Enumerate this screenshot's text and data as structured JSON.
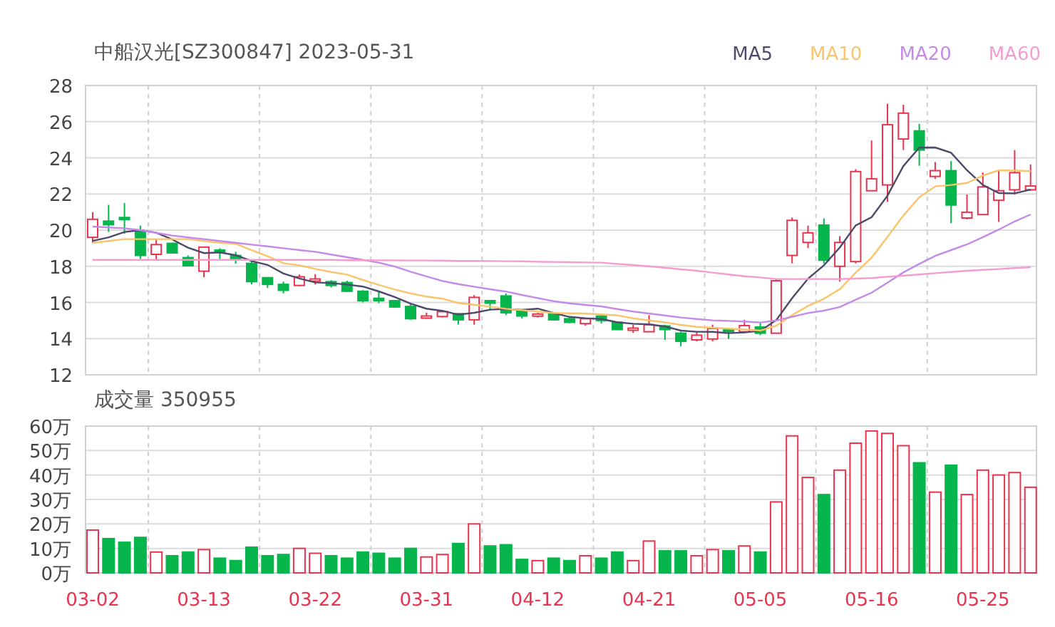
{
  "price_chart": {
    "title": "中船汉光[SZ300847] 2023-05-31",
    "chart_data": {
      "type": "candlestick",
      "grid": true,
      "ylim": [
        12,
        28
      ],
      "yticks": [
        12,
        14,
        16,
        18,
        20,
        22,
        24,
        26,
        28
      ],
      "categories": [
        null,
        null,
        null,
        null,
        null,
        null,
        null,
        null,
        null,
        null,
        null,
        null,
        null,
        null,
        null,
        null,
        null,
        null,
        null,
        null,
        null,
        null,
        null,
        null,
        null,
        null,
        null,
        null,
        null,
        null,
        null,
        null,
        null,
        null,
        null,
        null,
        null,
        null,
        null,
        null,
        null,
        null,
        null,
        null,
        null,
        null,
        null,
        null,
        null,
        null,
        null,
        null,
        null,
        null,
        null,
        null,
        null,
        null,
        null,
        null
      ],
      "series": [
        {
          "name": "MA5",
          "type": "line",
          "color": "#4b4a6b",
          "values": [
            19.4,
            19.6,
            19.9,
            20.0,
            19.86,
            19.49,
            19.03,
            18.73,
            18.77,
            18.61,
            18.29,
            18.08,
            17.6,
            17.33,
            17.11,
            17.07,
            16.99,
            16.88,
            16.61,
            16.3,
            15.93,
            15.66,
            15.54,
            15.33,
            15.43,
            15.6,
            15.64,
            15.59,
            15.66,
            15.41,
            15.2,
            15.13,
            15.08,
            14.91,
            14.82,
            14.79,
            14.67,
            14.44,
            14.38,
            14.37,
            14.3,
            14.34,
            14.43,
            15.03,
            16.23,
            17.32,
            18.05,
            19.05,
            20.26,
            20.72,
            21.91,
            23.54,
            24.56,
            24.57,
            24.28,
            23.31,
            22.5,
            22.05,
            22.03,
            22.24
          ]
        },
        {
          "name": "MA10",
          "type": "line",
          "color": "#f9c46b",
          "values": [
            19.3,
            19.4,
            19.5,
            19.5,
            19.5,
            19.5,
            19.5,
            19.4,
            19.3,
            19.24,
            18.89,
            18.56,
            18.17,
            18.05,
            17.86,
            17.68,
            17.54,
            17.24,
            16.97,
            16.71,
            16.5,
            16.33,
            16.21,
            15.97,
            15.87,
            15.77,
            15.65,
            15.57,
            15.5,
            15.42,
            15.4,
            15.39,
            15.34,
            15.29,
            15.12,
            15.0,
            14.9,
            14.76,
            14.65,
            14.6,
            14.55,
            14.51,
            14.44,
            14.71,
            15.3,
            15.81,
            16.2,
            16.74,
            17.65,
            18.48,
            19.62,
            20.8,
            21.81,
            22.42,
            22.5,
            22.61,
            23.02,
            23.31,
            23.3,
            23.26
          ]
        },
        {
          "name": "MA20",
          "type": "line",
          "color": "#c58ae8",
          "values": [
            20.2,
            20.15,
            20.1,
            20.0,
            19.85,
            19.7,
            19.6,
            19.5,
            19.4,
            19.3,
            19.2,
            19.1,
            19.0,
            18.9,
            18.8,
            18.65,
            18.5,
            18.35,
            18.2,
            17.98,
            17.7,
            17.45,
            17.19,
            17.01,
            16.87,
            16.73,
            16.6,
            16.41,
            16.24,
            16.07,
            15.95,
            15.86,
            15.78,
            15.63,
            15.5,
            15.39,
            15.28,
            15.17,
            15.08,
            15.01,
            14.98,
            14.95,
            14.89,
            15.0,
            15.21,
            15.41,
            15.55,
            15.75,
            16.15,
            16.54,
            17.09,
            17.66,
            18.13,
            18.57,
            18.9,
            19.21,
            19.61,
            20.03,
            20.48,
            20.87
          ]
        },
        {
          "name": "MA60",
          "type": "line",
          "color": "#f59ccf",
          "values": [
            18.35,
            18.35,
            18.35,
            18.35,
            18.35,
            18.35,
            18.35,
            18.35,
            18.35,
            18.35,
            18.35,
            18.35,
            18.35,
            18.35,
            18.35,
            18.35,
            18.34,
            18.34,
            18.33,
            18.33,
            18.32,
            18.32,
            18.31,
            18.3,
            18.3,
            18.29,
            18.28,
            18.27,
            18.25,
            18.24,
            18.23,
            18.21,
            18.2,
            18.13,
            18.07,
            18.0,
            17.92,
            17.83,
            17.75,
            17.65,
            17.55,
            17.45,
            17.38,
            17.3,
            17.3,
            17.3,
            17.3,
            17.3,
            17.32,
            17.35,
            17.42,
            17.48,
            17.55,
            17.62,
            17.68,
            17.75,
            17.8,
            17.85,
            17.9,
            17.95
          ]
        }
      ],
      "ohlc": [
        [
          19.6,
          21.0,
          19.3,
          20.6
        ],
        [
          20.5,
          21.4,
          19.9,
          20.3
        ],
        [
          20.7,
          21.5,
          19.8,
          20.6
        ],
        [
          19.95,
          20.25,
          18.4,
          18.6
        ],
        [
          18.66,
          19.5,
          18.35,
          19.2
        ],
        [
          19.27,
          19.3,
          18.7,
          18.74
        ],
        [
          18.48,
          18.6,
          18.0,
          18.03
        ],
        [
          17.73,
          19.06,
          17.4,
          19.06
        ],
        [
          18.9,
          19.0,
          18.4,
          18.8
        ],
        [
          18.6,
          18.8,
          18.15,
          18.4
        ],
        [
          18.16,
          18.27,
          17.0,
          17.15
        ],
        [
          17.37,
          17.4,
          16.8,
          17.0
        ],
        [
          17.0,
          17.15,
          16.5,
          16.67
        ],
        [
          16.94,
          17.55,
          16.9,
          17.42
        ],
        [
          17.2,
          17.57,
          17.0,
          17.3
        ],
        [
          17.15,
          17.23,
          16.83,
          16.94
        ],
        [
          17.1,
          17.2,
          16.57,
          16.62
        ],
        [
          16.62,
          16.68,
          16.0,
          16.1
        ],
        [
          16.23,
          16.6,
          15.96,
          16.1
        ],
        [
          16.1,
          16.1,
          15.7,
          15.75
        ],
        [
          15.78,
          15.9,
          15.04,
          15.1
        ],
        [
          15.17,
          15.43,
          15.1,
          15.25
        ],
        [
          15.22,
          15.57,
          15.17,
          15.49
        ],
        [
          15.38,
          15.43,
          14.77,
          15.04
        ],
        [
          15.04,
          16.41,
          14.77,
          16.28
        ],
        [
          16.1,
          16.1,
          15.62,
          15.96
        ],
        [
          16.36,
          16.5,
          15.3,
          15.43
        ],
        [
          15.57,
          15.62,
          15.12,
          15.25
        ],
        [
          15.25,
          15.43,
          15.17,
          15.36
        ],
        [
          15.36,
          15.4,
          15.0,
          15.04
        ],
        [
          15.1,
          15.15,
          14.85,
          14.9
        ],
        [
          14.83,
          15.17,
          14.72,
          15.1
        ],
        [
          15.25,
          15.3,
          14.83,
          15.0
        ],
        [
          14.9,
          14.93,
          14.5,
          14.5
        ],
        [
          14.5,
          14.77,
          14.32,
          14.58
        ],
        [
          14.38,
          15.3,
          14.38,
          14.77
        ],
        [
          14.7,
          14.77,
          13.93,
          14.5
        ],
        [
          14.3,
          14.38,
          13.58,
          13.85
        ],
        [
          13.93,
          14.38,
          13.85,
          14.19
        ],
        [
          13.98,
          14.77,
          13.85,
          14.56
        ],
        [
          14.5,
          14.59,
          13.98,
          14.38
        ],
        [
          14.38,
          15.04,
          14.3,
          14.72
        ],
        [
          14.64,
          14.9,
          14.19,
          14.3
        ],
        [
          14.3,
          17.28,
          14.3,
          17.2
        ],
        [
          18.6,
          20.7,
          18.16,
          20.54
        ],
        [
          19.32,
          20.25,
          19.0,
          19.85
        ],
        [
          20.28,
          20.65,
          18.16,
          18.34
        ],
        [
          18.0,
          19.67,
          17.15,
          19.32
        ],
        [
          18.26,
          23.37,
          18.16,
          23.24
        ],
        [
          22.18,
          24.96,
          22.18,
          22.84
        ],
        [
          22.5,
          26.99,
          21.57,
          25.83
        ],
        [
          25.04,
          26.94,
          24.43,
          26.47
        ],
        [
          25.49,
          25.88,
          23.56,
          24.43
        ],
        [
          22.97,
          23.77,
          22.84,
          23.29
        ],
        [
          23.29,
          23.82,
          20.38,
          21.39
        ],
        [
          20.67,
          21.97,
          20.59,
          20.99
        ],
        [
          20.86,
          23.19,
          20.86,
          22.39
        ],
        [
          21.65,
          23.29,
          20.46,
          22.18
        ],
        [
          22.23,
          24.43,
          21.97,
          23.18
        ],
        [
          22.23,
          23.63,
          22.18,
          22.44
        ]
      ]
    }
  },
  "volume_chart": {
    "title": "成交量 350955",
    "chart_data": {
      "type": "bar",
      "grid": true,
      "ylim": [
        0,
        60
      ],
      "categories": [
        "03-02",
        null,
        null,
        null,
        null,
        null,
        null,
        "03-13",
        null,
        null,
        null,
        null,
        null,
        null,
        "03-22",
        null,
        null,
        null,
        null,
        null,
        null,
        "03-31",
        null,
        null,
        null,
        null,
        null,
        null,
        "04-12",
        null,
        null,
        null,
        null,
        null,
        null,
        "04-21",
        null,
        null,
        null,
        null,
        null,
        null,
        "05-05",
        null,
        null,
        null,
        null,
        null,
        null,
        "05-16",
        null,
        null,
        null,
        null,
        null,
        null,
        "05-25",
        null,
        null,
        null
      ],
      "yticks": [
        {
          "value": 0,
          "label": "0万"
        },
        {
          "value": 10,
          "label": "10万"
        },
        {
          "value": 20,
          "label": "20万"
        },
        {
          "value": 30,
          "label": "30万"
        },
        {
          "value": 40,
          "label": "40万"
        },
        {
          "value": 50,
          "label": "50万"
        },
        {
          "value": 60,
          "label": "60万"
        }
      ],
      "values": [
        17.5,
        14,
        12.5,
        14.5,
        8.5,
        7,
        8.5,
        9.5,
        6,
        5,
        10.5,
        7,
        7.5,
        10,
        8,
        7,
        6,
        8.5,
        8,
        6,
        10,
        6.5,
        7.5,
        12,
        20,
        11,
        11.5,
        5.5,
        5,
        6,
        5,
        7,
        6,
        8.5,
        5,
        13,
        9,
        9,
        7,
        9.5,
        9,
        11,
        8.5,
        29,
        56,
        39,
        32,
        42,
        53,
        58,
        57,
        52,
        45,
        33,
        44,
        32,
        42,
        40,
        41,
        35
      ]
    }
  }
}
